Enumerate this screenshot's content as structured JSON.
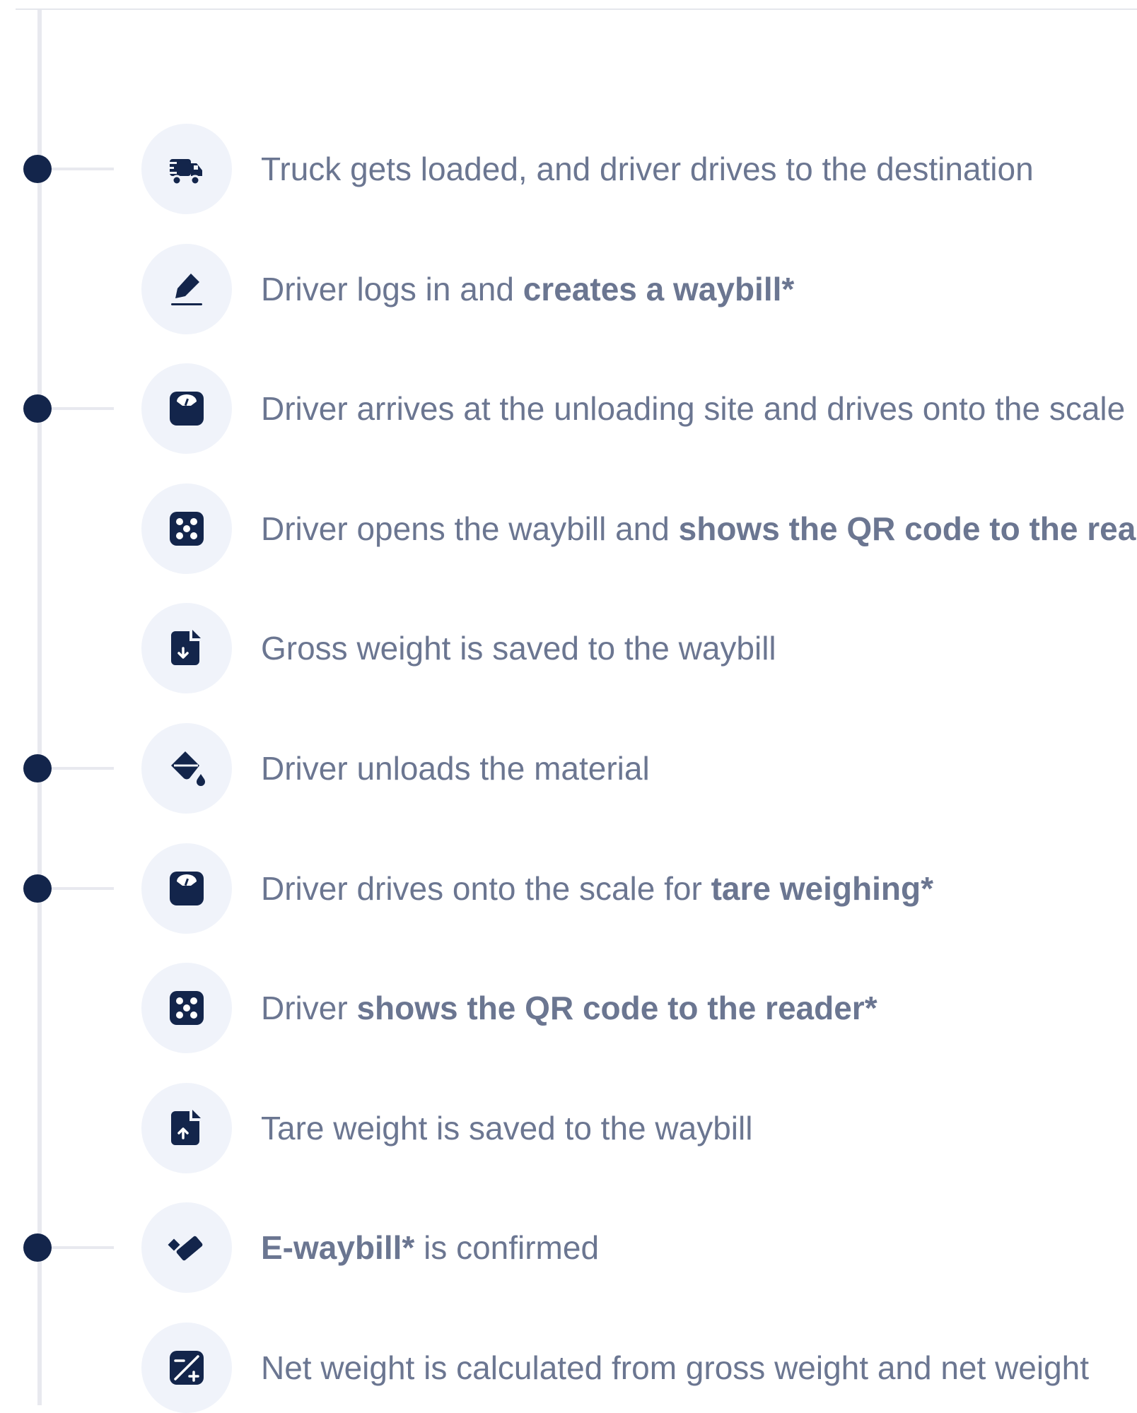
{
  "steps": [
    {
      "icon": "truck-fast-icon",
      "milestone": true,
      "parts": [
        {
          "text": "Truck gets loaded, and driver drives to the destination",
          "bold": false
        }
      ]
    },
    {
      "icon": "pen-signature-icon",
      "milestone": false,
      "parts": [
        {
          "text": "Driver logs in and ",
          "bold": false
        },
        {
          "text": "creates a waybill*",
          "bold": true
        }
      ]
    },
    {
      "icon": "scale-icon",
      "milestone": true,
      "parts": [
        {
          "text": "Driver arrives at the unloading site and drives onto the scale",
          "bold": false
        }
      ]
    },
    {
      "icon": "qr-reader-icon",
      "milestone": false,
      "parts": [
        {
          "text": "Driver opens the waybill and ",
          "bold": false
        },
        {
          "text": "shows the QR code to the rea",
          "bold": true
        }
      ]
    },
    {
      "icon": "file-download-icon",
      "milestone": false,
      "parts": [
        {
          "text": "Gross weight is saved to the waybill",
          "bold": false
        }
      ]
    },
    {
      "icon": "fill-drip-icon",
      "milestone": true,
      "parts": [
        {
          "text": "Driver unloads the material",
          "bold": false
        }
      ]
    },
    {
      "icon": "scale-icon",
      "milestone": true,
      "parts": [
        {
          "text": "Driver drives onto the scale for ",
          "bold": false
        },
        {
          "text": "tare weighing*",
          "bold": true
        }
      ]
    },
    {
      "icon": "qr-reader-icon",
      "milestone": false,
      "parts": [
        {
          "text": "Driver ",
          "bold": false
        },
        {
          "text": "shows the QR code to the reader*",
          "bold": true
        }
      ]
    },
    {
      "icon": "file-upload-icon",
      "milestone": false,
      "parts": [
        {
          "text": "Tare weight is saved to the waybill",
          "bold": false
        }
      ]
    },
    {
      "icon": "check-badge-icon",
      "milestone": true,
      "parts": [
        {
          "text": "E-waybill*",
          "bold": true
        },
        {
          "text": " is confirmed",
          "bold": false
        }
      ]
    },
    {
      "icon": "calculator-icon",
      "milestone": false,
      "parts": [
        {
          "text": "Net weight is calculated from gross weight and net weight",
          "bold": false
        }
      ]
    }
  ],
  "colors": {
    "dot": "#13254b",
    "icon": "#13254b",
    "icon_bg": "#f0f3fa",
    "text": "#6b7691",
    "line": "#e8e9ef"
  }
}
